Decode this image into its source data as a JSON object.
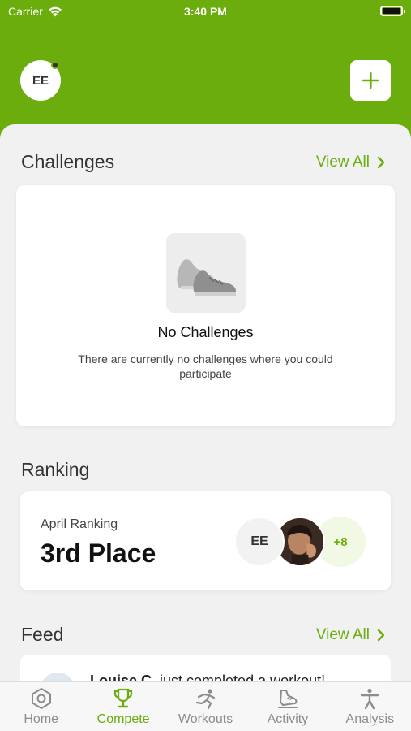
{
  "status_bar": {
    "carrier": "Carrier",
    "time": "3:40 PM"
  },
  "header": {
    "avatar_initials": "EE",
    "add_icon": "plus-icon"
  },
  "challenges": {
    "title": "Challenges",
    "view_all": "View All",
    "empty_title": "No Challenges",
    "empty_text": "There are currently no challenges where you could participate"
  },
  "ranking": {
    "title": "Ranking",
    "label": "April Ranking",
    "value": "3rd Place",
    "participants": {
      "initials": "EE",
      "more": "+8"
    }
  },
  "feed": {
    "title": "Feed",
    "view_all": "View All",
    "item_name": "Louise C.",
    "item_text": " just completed a workout!"
  },
  "tabs": [
    {
      "label": "Home",
      "icon": "home-icon"
    },
    {
      "label": "Compete",
      "icon": "trophy-icon",
      "active": true
    },
    {
      "label": "Workouts",
      "icon": "workout-icon"
    },
    {
      "label": "Activity",
      "icon": "activity-icon"
    },
    {
      "label": "Analysis",
      "icon": "analysis-icon"
    }
  ],
  "colors": {
    "accent": "#6aad0c",
    "background": "#f1f1f1"
  }
}
